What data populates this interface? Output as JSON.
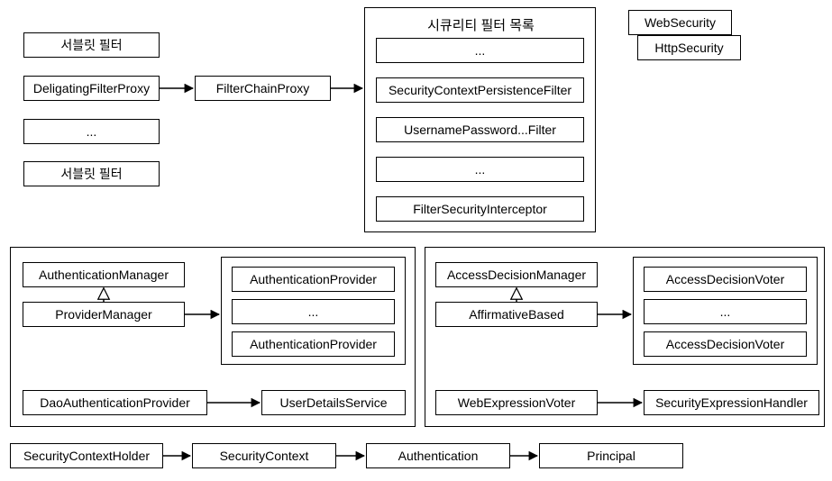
{
  "servletFilters": {
    "top": "서블릿 필터",
    "deligating": "DeligatingFilterProxy",
    "ellipsis": "...",
    "bottom": "서블릿 필터"
  },
  "filterChainProxy": "FilterChainProxy",
  "securityFilterList": {
    "title": "시큐리티 필터 목록",
    "items": [
      "...",
      "SecurityContextPersistenceFilter",
      "UsernamePassword...Filter",
      "...",
      "FilterSecurityInterceptor"
    ]
  },
  "webSecurity": "WebSecurity",
  "httpSecurity": "HttpSecurity",
  "authGroup": {
    "authenticationManager": "AuthenticationManager",
    "providerManager": "ProviderManager",
    "providers": [
      "AuthenticationProvider",
      "...",
      "AuthenticationProvider"
    ],
    "daoAuthProvider": "DaoAuthenticationProvider",
    "userDetailsService": "UserDetailsService"
  },
  "accessGroup": {
    "accessDecisionManager": "AccessDecisionManager",
    "affirmativeBased": "AffirmativeBased",
    "voters": [
      "AccessDecisionVoter",
      "...",
      "AccessDecisionVoter"
    ],
    "webExpressionVoter": "WebExpressionVoter",
    "securityExpressionHandler": "SecurityExpressionHandler"
  },
  "bottomChain": {
    "securityContextHolder": "SecurityContextHolder",
    "securityContext": "SecurityContext",
    "authentication": "Authentication",
    "principal": "Principal"
  }
}
